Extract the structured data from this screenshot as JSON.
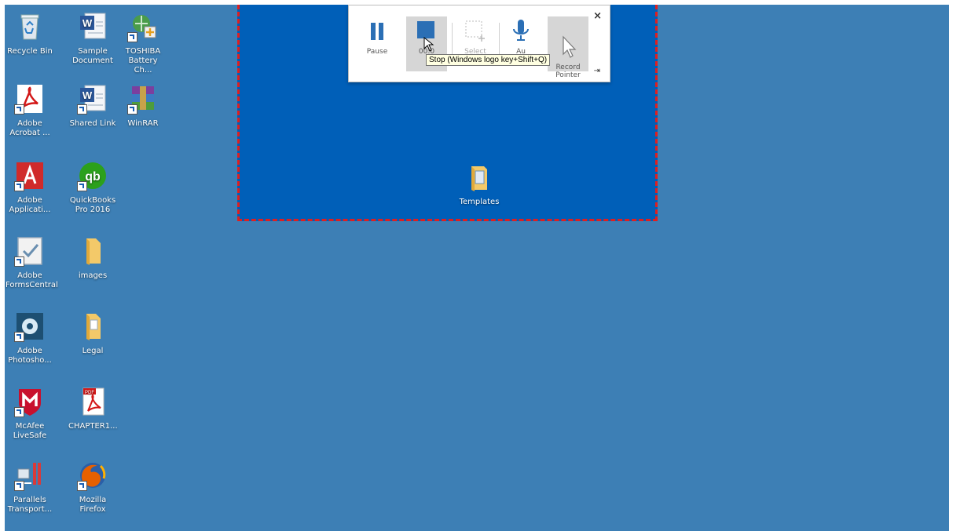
{
  "desktop_icons": [
    {
      "label": "Recycle Bin",
      "icon": "recycle-bin-icon"
    },
    {
      "label": "Sample Document",
      "icon": "word-document-icon"
    },
    {
      "label": "TOSHIBA Battery Ch...",
      "icon": "toshiba-battery-icon"
    },
    {
      "label": "Adobe Acrobat ...",
      "icon": "adobe-acrobat-icon"
    },
    {
      "label": "Shared Link",
      "icon": "word-document-icon"
    },
    {
      "label": "WinRAR",
      "icon": "winrar-icon"
    },
    {
      "label": "Adobe Applicati...",
      "icon": "adobe-application-manager-icon"
    },
    {
      "label": "QuickBooks Pro 2016",
      "icon": "quickbooks-icon"
    },
    {
      "label": "Adobe FormsCentral",
      "icon": "adobe-formscentral-icon"
    },
    {
      "label": "images",
      "icon": "folder-icon"
    },
    {
      "label": "Adobe Photosho...",
      "icon": "adobe-photoshop-icon"
    },
    {
      "label": "Legal",
      "icon": "folder-icon"
    },
    {
      "label": "McAfee LiveSafe",
      "icon": "mcafee-icon"
    },
    {
      "label": "CHAPTER1...",
      "icon": "pdf-file-icon"
    },
    {
      "label": "Parallels Transport...",
      "icon": "parallels-transporter-icon"
    },
    {
      "label": "Mozilla Firefox",
      "icon": "firefox-icon"
    }
  ],
  "region_icons": [
    {
      "label": "Templates",
      "icon": "folder-icon"
    }
  ],
  "toolbar": {
    "pause_label": "Pause",
    "stop_label": "00:0",
    "select_label": "Select",
    "audio_label": "Au",
    "record_pointer_label": "Record\nPointer",
    "close_label": "×",
    "pin_label": "⇥"
  },
  "tooltip": {
    "text": "Stop (Windows logo key+Shift+Q)"
  },
  "colors": {
    "desktop_bg": "#3d7fb5",
    "region_bg": "#005fb8",
    "region_border": "#e01e1e"
  }
}
